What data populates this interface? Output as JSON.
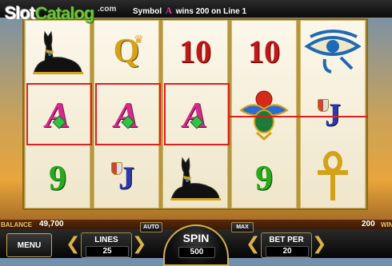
{
  "logo": {
    "part1": "Slot",
    "part2": "Catalog"
  },
  "header": {
    "domain": ".com",
    "message_prefix": "Symbol",
    "message_symbol": "A",
    "message_suffix": "wins 200 on Line 1"
  },
  "reels": [
    [
      "cat",
      "A",
      "9"
    ],
    [
      "Q",
      "A",
      "J"
    ],
    [
      "10",
      "A",
      "cat"
    ],
    [
      "10",
      "scarab",
      "9"
    ],
    [
      "eye",
      "J",
      "ankh"
    ]
  ],
  "winning_positions": [
    [
      0,
      1
    ],
    [
      1,
      1
    ],
    [
      2,
      1
    ]
  ],
  "footer": {
    "balance_label": "BALANCE",
    "balance_value": "49,700",
    "win_value": "200",
    "win_label": "WIN",
    "menu_label": "MENU",
    "lines_label": "LINES",
    "lines_value": "25",
    "auto_label": "AUTO",
    "spin_label": "SPIN",
    "spin_value": "500",
    "max_label": "MAX",
    "bet_label": "BET PER",
    "bet_value": "20"
  },
  "colors": {
    "win_frame": "#e21d1d",
    "ten": "#c01818",
    "nine": "#2aa81e",
    "jack": "#2a3aa8",
    "queen": "#d4a11a",
    "ace": "#d42a8c"
  }
}
